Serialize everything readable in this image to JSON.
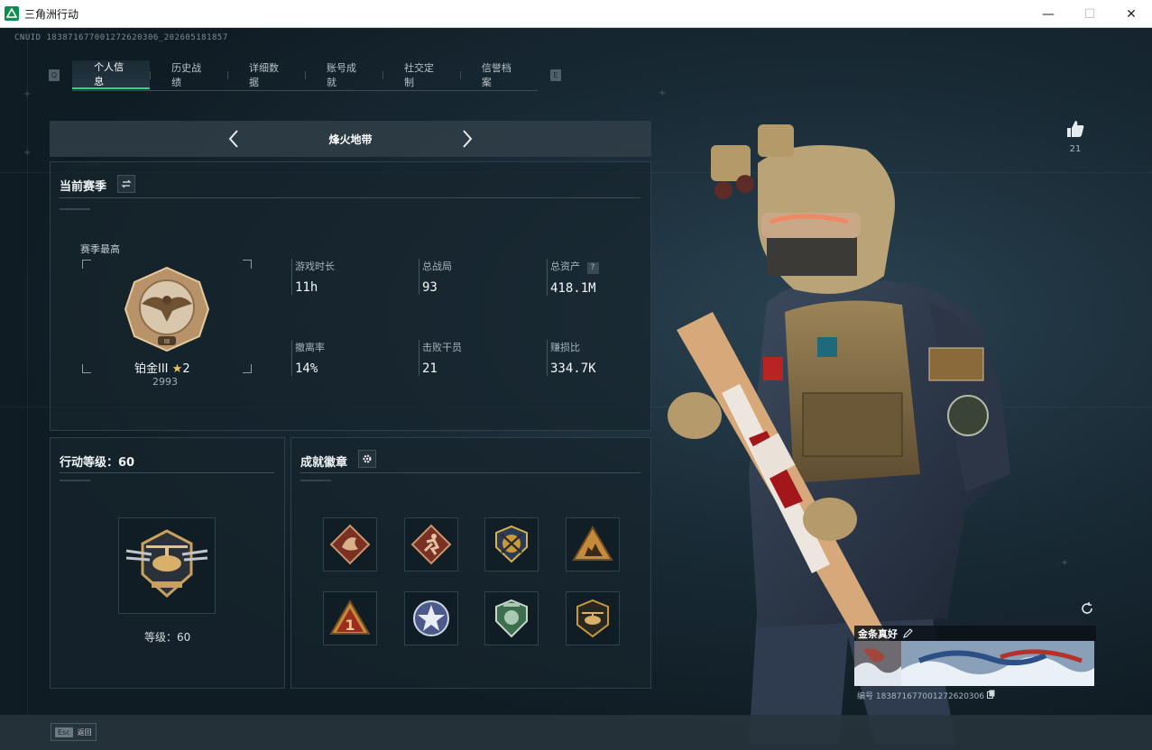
{
  "window": {
    "title": "三角洲行动",
    "minimize": "—",
    "maximize": "☐",
    "close": "✕"
  },
  "uid": "CNUID 18387167700127262​0306_202605181857",
  "tabs": {
    "left_key": "Q",
    "right_key": "E",
    "items": [
      {
        "label": "个人信息",
        "active": true
      },
      {
        "label": "历史战绩",
        "active": false
      },
      {
        "label": "详细数据",
        "active": false
      },
      {
        "label": "账号成就",
        "active": false
      },
      {
        "label": "社交定制",
        "active": false
      },
      {
        "label": "信誉档案",
        "active": false
      }
    ]
  },
  "mode": {
    "label": "烽火地带"
  },
  "season": {
    "title": "当前赛季",
    "best_label": "赛季最高",
    "rank_name": "铂金III",
    "rank_stars": "2",
    "rank_score": "2993",
    "stats": [
      {
        "label": "游戏时长",
        "value": "11h"
      },
      {
        "label": "总战局",
        "value": "93"
      },
      {
        "label": "总资产",
        "value": "418.1M",
        "help": "?"
      },
      {
        "label": "撤离率",
        "value": "14%"
      },
      {
        "label": "击败干员",
        "value": "21"
      },
      {
        "label": "赚损比",
        "value": "334.7K"
      }
    ]
  },
  "level_panel": {
    "title": "行动等级：60",
    "level_label": "等级：60"
  },
  "badges": {
    "title": "成就徽章",
    "items": [
      {
        "icon": "dragon-badge-icon"
      },
      {
        "icon": "runner-badge-icon"
      },
      {
        "icon": "crossed-guns-badge-icon"
      },
      {
        "icon": "triangle-squad-badge-icon"
      },
      {
        "icon": "number-one-badge-icon"
      },
      {
        "icon": "star-badge-icon"
      },
      {
        "icon": "shield-badge-icon"
      },
      {
        "icon": "helicopter-badge-icon"
      }
    ]
  },
  "likes": {
    "count": "21"
  },
  "card": {
    "name": "金条真好",
    "id": "编号 18387167700127262​0306"
  },
  "bottom": {
    "esc_key": "Esc",
    "esc_label": "返回"
  },
  "colors": {
    "accent": "#1fdc88",
    "gold": "#c9a15c"
  }
}
